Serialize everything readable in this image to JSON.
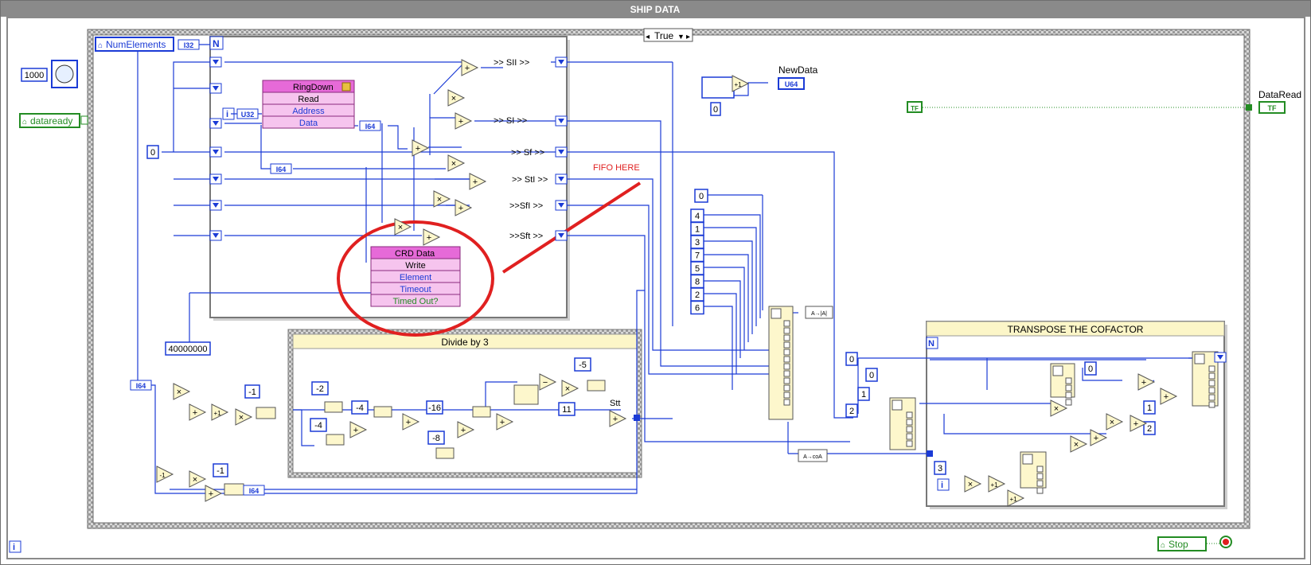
{
  "window": {
    "title": "SHIP DATA"
  },
  "case_selector": "True",
  "constants": {
    "c1000": "1000",
    "c0_left": "0",
    "c40000000": "40000000",
    "n_neg1_a": "-1",
    "n_neg1_b": "-1",
    "c0_shift": "0",
    "c0_matrix": "0",
    "matrix_indices": [
      "4",
      "1",
      "3",
      "7",
      "5",
      "8",
      "2",
      "6"
    ],
    "c0_t1": "0",
    "c0_t2": "0",
    "c1": "1",
    "c2": "2",
    "c0_t3": "0",
    "c1_t": "1",
    "c2_t": "2",
    "c3": "3"
  },
  "controls": {
    "num_elements": "NumElements",
    "dataready": "dataready",
    "stop": "Stop",
    "data_read": "DataRead",
    "new_data": "NewData"
  },
  "types": {
    "i32": "I32",
    "u32": "U32",
    "i64": "I64",
    "u64": "U64",
    "tf": "TF"
  },
  "for_loop": {
    "n": "N",
    "i": "i"
  },
  "ringdown": {
    "title": "RingDown",
    "rows": [
      "Read",
      "Address",
      "Data"
    ]
  },
  "crd": {
    "title": "CRD Data",
    "rows": [
      "Write",
      "Element",
      "Timeout",
      "Timed Out?"
    ]
  },
  "shift_labels": [
    ">> SII >>",
    ">> SI >>",
    ">> Sf >>",
    ">> StI >>",
    ">>SfI >>",
    ">>Sft >>"
  ],
  "annotation": "FIFO HERE",
  "divide": {
    "title": "Divide by 3",
    "consts": [
      "-2",
      "-4",
      "-4",
      "-16",
      "-8",
      "-5",
      "11"
    ],
    "stt": "Stt"
  },
  "transpose": {
    "title": "TRANSPOSE THE COFACTOR"
  },
  "abs_label": "A→|A|",
  "cofactor_label": "A→coA",
  "prims": {
    "plus": "+",
    "times": "×",
    "minus": "−",
    "plus1": "+1",
    "minus1": "-1"
  },
  "colors": {
    "wire_blue": "#1b3bd6",
    "wire_green": "#238c23",
    "pink": "#f6c4ee",
    "yellow_prim": "#fdf7cc",
    "struct_border": "#7a7a7a",
    "title_bar": "#8a8a8a",
    "annotation_red": "#e02020"
  }
}
